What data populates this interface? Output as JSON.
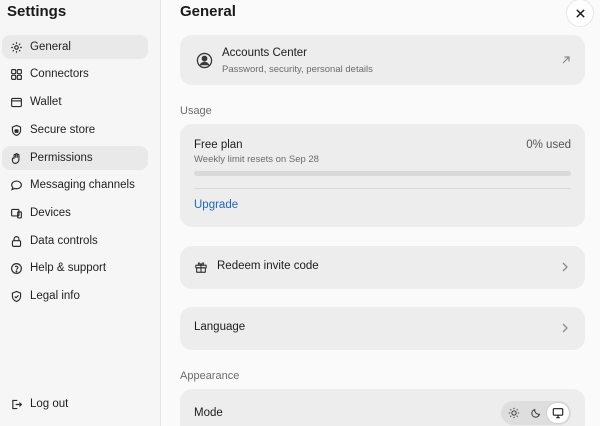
{
  "sidebar": {
    "title": "Settings",
    "items": [
      {
        "label": "General",
        "icon": "gear-icon",
        "active": true
      },
      {
        "label": "Connectors",
        "icon": "grid-icon"
      },
      {
        "label": "Wallet",
        "icon": "wallet-icon"
      },
      {
        "label": "Secure store",
        "icon": "shield-lock-icon"
      },
      {
        "label": "Permissions",
        "icon": "hand-icon",
        "active": true
      },
      {
        "label": "Messaging channels",
        "icon": "chat-bubble-icon"
      },
      {
        "label": "Devices",
        "icon": "devices-icon"
      },
      {
        "label": "Data controls",
        "icon": "lock-icon"
      },
      {
        "label": "Help & support",
        "icon": "help-circle-icon"
      },
      {
        "label": "Legal info",
        "icon": "shield-check-icon"
      }
    ],
    "logout_label": "Log out"
  },
  "main": {
    "title": "General",
    "accounts": {
      "title": "Accounts Center",
      "subtitle": "Password, security, personal details"
    },
    "usage": {
      "section_label": "Usage",
      "plan_name": "Free plan",
      "used_text": "0% used",
      "used_percent": 0,
      "reset_text": "Weekly limit resets on Sep 28",
      "upgrade_label": "Upgrade"
    },
    "redeem_label": "Redeem invite code",
    "language_label": "Language",
    "appearance": {
      "section_label": "Appearance",
      "mode_label": "Mode",
      "mode_options": [
        "sun-icon",
        "moon-icon",
        "monitor-icon"
      ],
      "selected_mode": "monitor-icon"
    }
  },
  "colors": {
    "accent_link": "#2367b8",
    "card_bg": "#ededed",
    "active_nav_bg": "#e9e9e9"
  }
}
